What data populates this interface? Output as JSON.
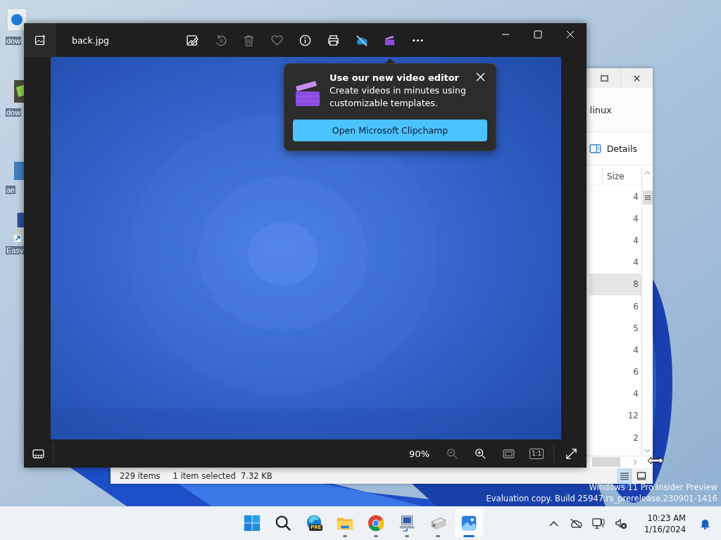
{
  "desktop": {
    "icons": [
      {
        "kind": "recycle",
        "label": "dow"
      },
      {
        "label": "dow"
      },
      {
        "kind": "tile",
        "label": "ae"
      },
      {
        "kind": "computer",
        "label": "Easy"
      }
    ],
    "watermark": [
      "Windows 11 Pro Insider Preview",
      "Evaluation copy. Build 25947.rs_prerelease.230901-1416"
    ]
  },
  "explorer": {
    "path_fragment": "linux",
    "view_button": "Details",
    "size_header": "Size",
    "rows": [
      {
        "size": "4",
        "selected": false
      },
      {
        "size": "4",
        "selected": false
      },
      {
        "size": "4",
        "selected": false
      },
      {
        "size": "4",
        "selected": false
      },
      {
        "size": "8",
        "selected": true
      },
      {
        "size": "6",
        "selected": false
      },
      {
        "size": "5",
        "selected": false
      },
      {
        "size": "4",
        "selected": false
      },
      {
        "size": "6",
        "selected": false
      },
      {
        "size": "4",
        "selected": false
      },
      {
        "size": "12",
        "selected": false
      },
      {
        "size": "2",
        "selected": false
      }
    ],
    "status": {
      "count": "229 items",
      "selection": "1 item selected  7.32 KB"
    },
    "views": [
      {
        "kind": "details",
        "selected": true
      },
      {
        "kind": "tiles",
        "selected": false
      }
    ]
  },
  "photos": {
    "title": "back.jpg",
    "toolbar": [
      {
        "kind": "edit",
        "disabled": false
      },
      {
        "kind": "rotate",
        "disabled": true
      },
      {
        "kind": "delete",
        "disabled": true
      },
      {
        "kind": "favorite",
        "disabled": true
      },
      {
        "kind": "info",
        "disabled": false
      },
      {
        "kind": "print",
        "disabled": false
      },
      {
        "kind": "cloud"
      },
      {
        "kind": "clipchamp"
      },
      {
        "kind": "more",
        "disabled": false
      }
    ],
    "zoom": "90%",
    "zoom_out_disabled": true,
    "actual_size": "1:1"
  },
  "popup": {
    "title": "Use our new video editor",
    "body": "Create videos in minutes using customizable templates.",
    "button": "Open Microsoft Clipchamp"
  },
  "taskbar": {
    "apps": [
      {
        "kind": "start",
        "running": false,
        "active": false
      },
      {
        "kind": "search",
        "running": false,
        "active": false
      },
      {
        "kind": "edge",
        "running": false,
        "active": false,
        "badge": "PRE"
      },
      {
        "kind": "folder",
        "running": true,
        "active": false
      },
      {
        "kind": "chrome",
        "running": true,
        "active": false
      },
      {
        "kind": "network",
        "running": true,
        "active": false
      },
      {
        "kind": "usb",
        "running": true,
        "active": false
      },
      {
        "kind": "photos",
        "running": true,
        "active": true
      }
    ],
    "time": "10:23 AM",
    "date": "1/16/2024"
  }
}
